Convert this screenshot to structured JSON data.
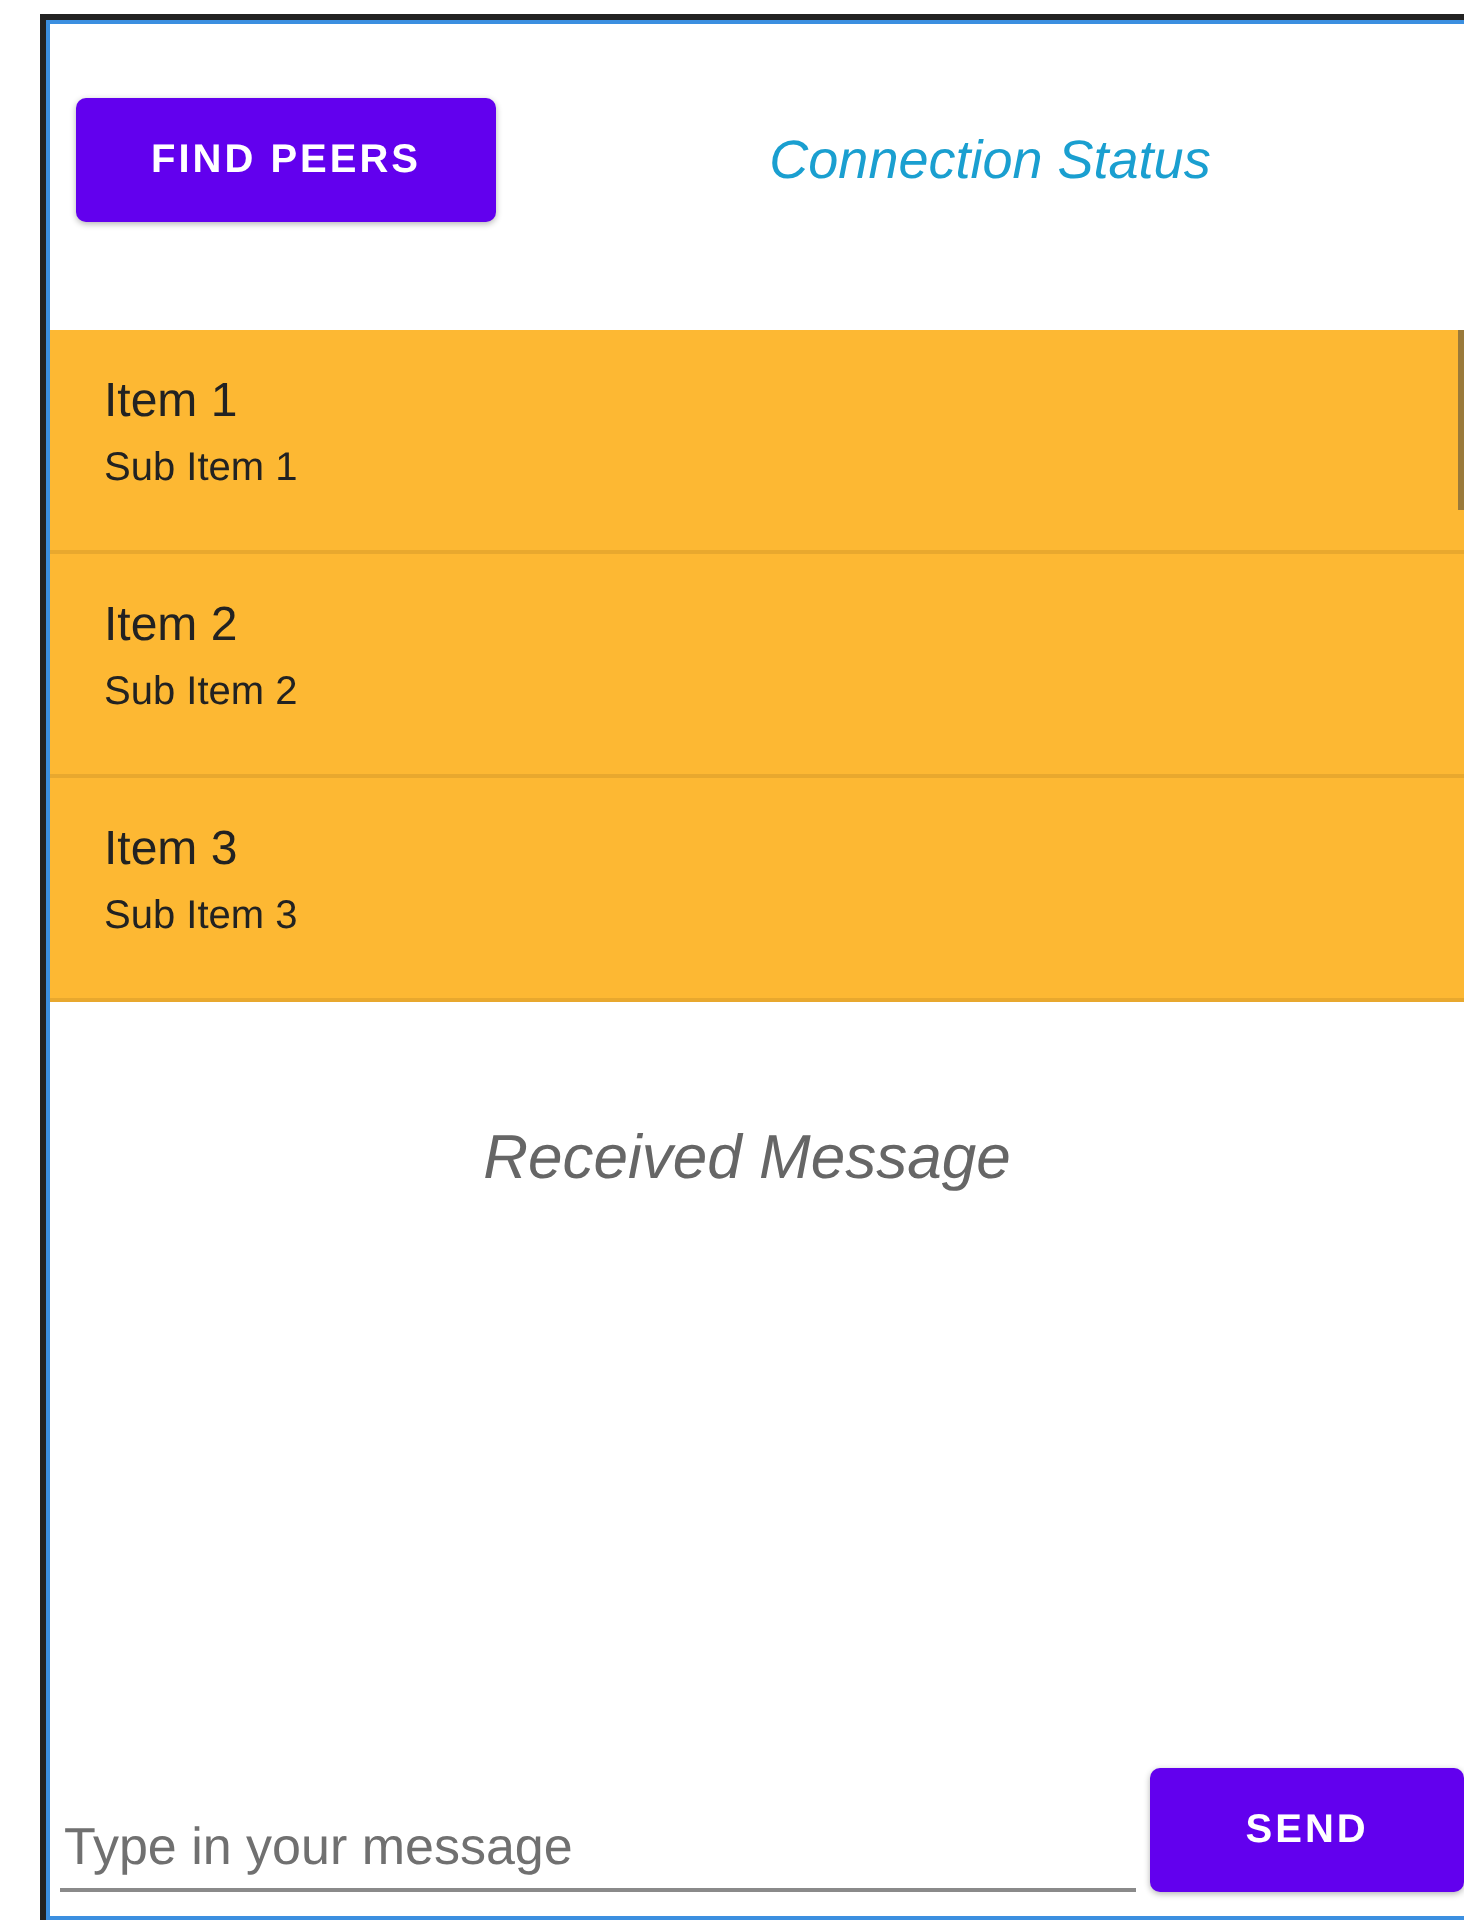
{
  "find_peers_button": "FIND PEERS",
  "connection_status": "Connection Status",
  "peers": [
    {
      "title": "Item 1",
      "subtitle": "Sub Item 1"
    },
    {
      "title": "Item 2",
      "subtitle": "Sub Item 2"
    },
    {
      "title": "Item 3",
      "subtitle": "Sub Item 3"
    }
  ],
  "received_message": "Received Message",
  "message_field": {
    "placeholder": "Type in your message"
  },
  "send_button": "SEND"
}
